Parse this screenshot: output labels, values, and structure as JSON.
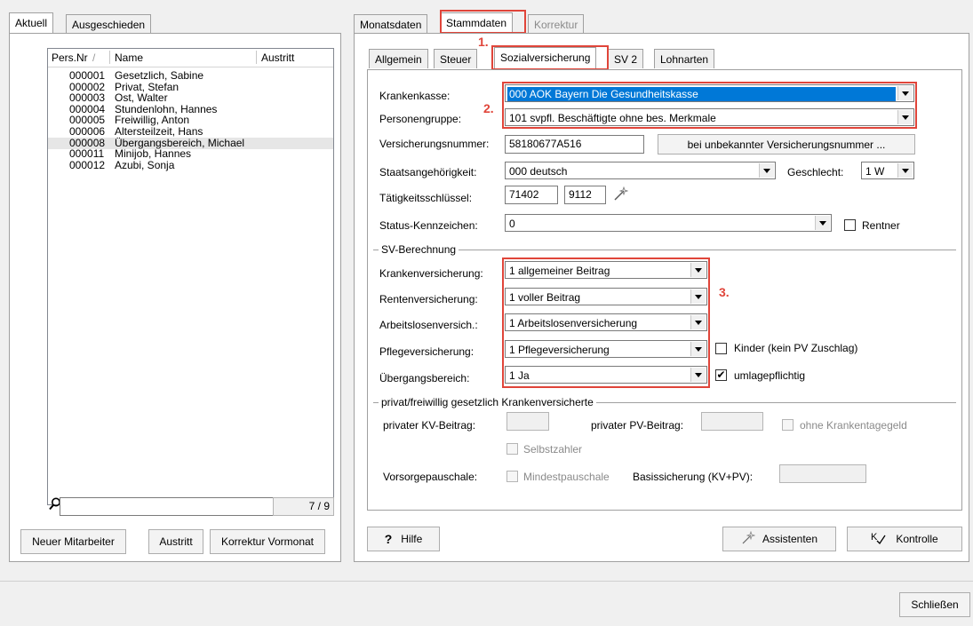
{
  "left_tabs": [
    "Aktuell",
    "Ausgeschieden"
  ],
  "list": {
    "columns": [
      "Pers.Nr",
      "/",
      "Name",
      "Austritt"
    ],
    "rows": [
      {
        "nr": "000001",
        "name": "Gesetzlich, Sabine"
      },
      {
        "nr": "000002",
        "name": "Privat, Stefan"
      },
      {
        "nr": "000003",
        "name": "Ost, Walter"
      },
      {
        "nr": "000004",
        "name": "Stundenlohn, Hannes"
      },
      {
        "nr": "000005",
        "name": "Freiwillig, Anton"
      },
      {
        "nr": "000006",
        "name": "Altersteilzeit, Hans"
      },
      {
        "nr": "000008",
        "name": "Übergangsbereich, Michael"
      },
      {
        "nr": "000011",
        "name": "Minijob, Hannes"
      },
      {
        "nr": "000012",
        "name": "Azubi, Sonja"
      }
    ],
    "selected_index": 6,
    "count": "7 / 9"
  },
  "left_buttons": {
    "new": "Neuer Mitarbeiter",
    "exit": "Austritt",
    "correction": "Korrektur Vormonat"
  },
  "top_tabs": [
    "Monatsdaten",
    "Stammdaten",
    "Korrektur"
  ],
  "sub_tabs": [
    "Allgemein",
    "Steuer",
    "Sozialversicherung",
    "SV 2",
    "Lohnarten"
  ],
  "form": {
    "krankenkasse_label": "Krankenkasse:",
    "krankenkasse_value": "000 AOK Bayern Die Gesundheitskasse",
    "personengruppe_label": "Personengruppe:",
    "personengruppe_value": "101 svpfl. Beschäftigte ohne bes. Merkmale",
    "versnr_label": "Versicherungsnummer:",
    "versnr_value": "58180677A516",
    "versnr_button": "bei unbekannter Versicherungsnummer ...",
    "staat_label": "Staatsangehörigkeit:",
    "staat_value": "000 deutsch",
    "geschlecht_label": "Geschlecht:",
    "geschlecht_value": "1 W",
    "taet_label": "Tätigkeitsschlüssel:",
    "taet_value1": "71402",
    "taet_value2": "9112",
    "status_label": "Status-Kennzeichen:",
    "status_value": "0",
    "rentner_label": "Rentner"
  },
  "sv": {
    "group_title": "SV-Berechnung",
    "kv_label": "Krankenversicherung:",
    "kv_value": "1 allgemeiner Beitrag",
    "rv_label": "Rentenversicherung:",
    "rv_value": "1 voller Beitrag",
    "av_label": "Arbeitslosenversich.:",
    "av_value": "1 Arbeitslosenversicherung",
    "pv_label": "Pflegeversicherung:",
    "pv_value": "1 Pflegeversicherung",
    "ueb_label": "Übergangsbereich:",
    "ueb_value": "1 Ja",
    "kinder_label": "Kinder (kein PV Zuschlag)",
    "umlage_label": "umlagepflichtig",
    "umlage_checked": "✔"
  },
  "privat": {
    "group_title": "privat/freiwillig gesetzlich Krankenversicherte",
    "kv_label": "privater KV-Beitrag:",
    "pv_label": "privater PV-Beitrag:",
    "ohne_label": "ohne Krankentagegeld",
    "selbst_label": "Selbstzahler",
    "vorsorge_label": "Vorsorgepauschale:",
    "mindest_label": "Mindestpauschale",
    "basis_label": "Basissicherung (KV+PV):"
  },
  "annotations": {
    "a1": "1.",
    "a2": "2.",
    "a3": "3."
  },
  "bottom_buttons": {
    "hilfe_icon": "?",
    "hilfe": "Hilfe",
    "assistenten": "Assistenten",
    "kontrolle": "Kontrolle",
    "schliessen": "Schließen"
  },
  "colors": {
    "annotation": "#e0453a",
    "selection": "#0078d7"
  }
}
